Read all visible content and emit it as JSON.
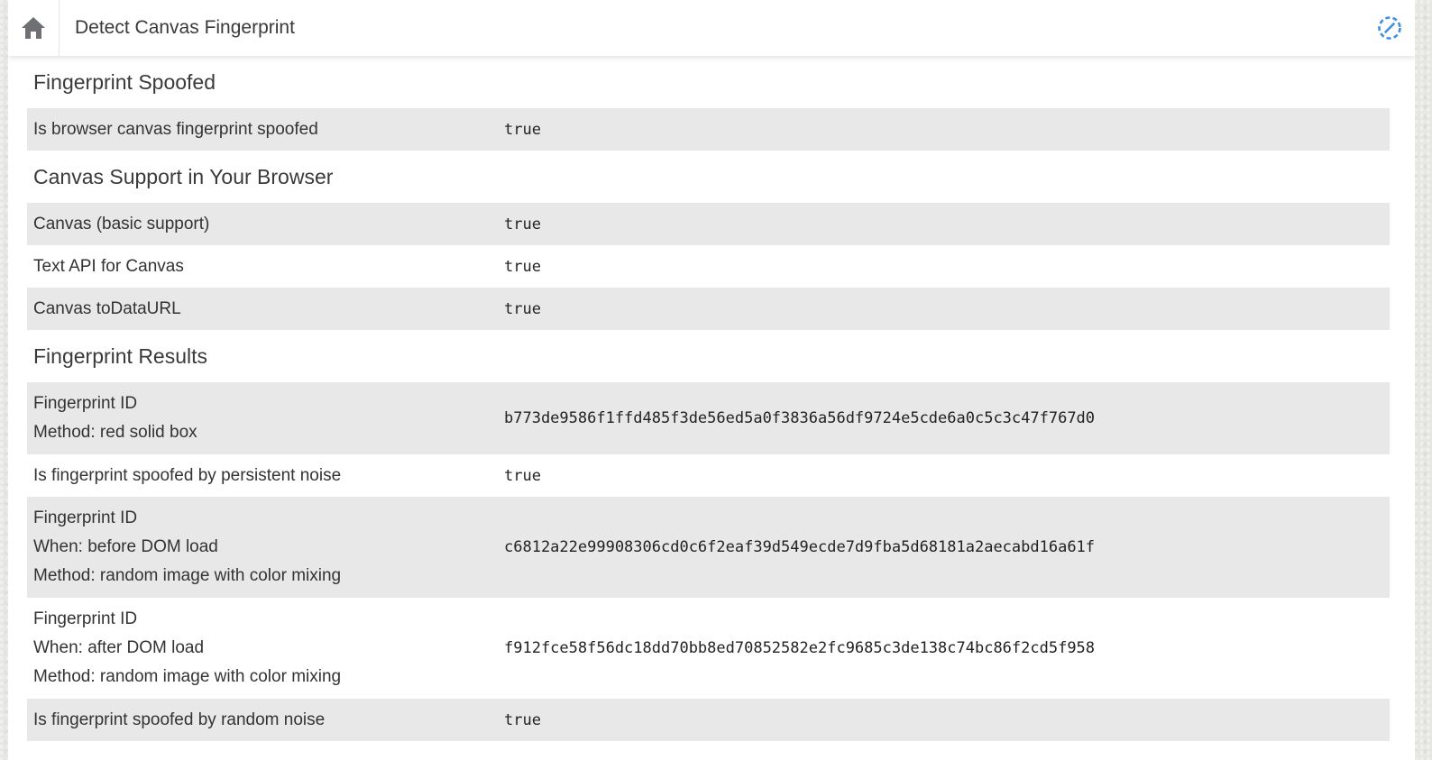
{
  "header": {
    "title": "Detect Canvas Fingerprint",
    "home_icon": "home-icon",
    "action_icon": "dashed-circle-slash-icon",
    "accent": "#3d8fe0"
  },
  "sections": {
    "spoofed": {
      "title": "Fingerprint Spoofed",
      "rows": [
        {
          "label": "Is browser canvas fingerprint spoofed",
          "value": "true"
        }
      ]
    },
    "support": {
      "title": "Canvas Support in Your Browser",
      "rows": [
        {
          "label": "Canvas (basic support)",
          "value": "true"
        },
        {
          "label": "Text API for Canvas",
          "value": "true"
        },
        {
          "label": "Canvas toDataURL",
          "value": "true"
        }
      ]
    },
    "results": {
      "title": "Fingerprint Results",
      "rows": [
        {
          "lines": [
            "Fingerprint ID",
            "Method: red solid box"
          ],
          "value": "b773de9586f1ffd485f3de56ed5a0f3836a56df9724e5cde6a0c5c3c47f767d0"
        },
        {
          "label": "Is fingerprint spoofed by persistent noise",
          "value": "true"
        },
        {
          "lines": [
            "Fingerprint ID",
            "When: before DOM load",
            "Method: random image with color mixing"
          ],
          "value": "c6812a22e99908306cd0c6f2eaf39d549ecde7d9fba5d68181a2aecabd16a61f"
        },
        {
          "lines": [
            "Fingerprint ID",
            "When: after DOM load",
            "Method: random image with color mixing"
          ],
          "value": "f912fce58f56dc18dd70bb8ed70852582e2fc9685c3de138c74bc86f2cd5f958"
        },
        {
          "label": "Is fingerprint spoofed by random noise",
          "value": "true"
        }
      ]
    }
  }
}
